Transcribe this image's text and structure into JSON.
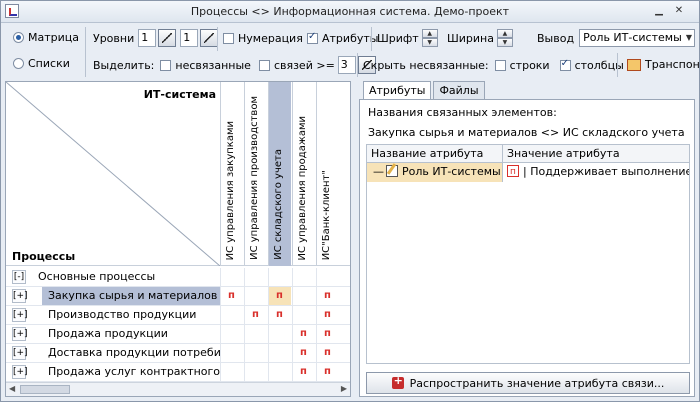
{
  "window": {
    "title": "Процессы <> Информационная система. Демо-проект"
  },
  "toolbar": {
    "mode_matrix": "Матрица",
    "mode_lists": "Списки",
    "levels_label": "Уровни",
    "levels_value_1": "1",
    "levels_value_2": "1",
    "numbering_label": "Нумерация",
    "attributes_label": "Атрибуты",
    "font_label": "Шрифт",
    "width_label": "Ширина",
    "output_label": "Вывод",
    "output_value": "Роль ИТ-системы",
    "highlight_label": "Выделить:",
    "unlinked_label": "несвязанные",
    "links_label": "связей >=",
    "links_value": "3",
    "hide_unlinked_label": "Скрыть несвязанные:",
    "rows_label": "строки",
    "cols_label": "столбцы",
    "transpose_label": "Транспон"
  },
  "matrix": {
    "column_header": "ИТ-система",
    "row_header": "Процессы",
    "columns": [
      "ИС управления закупками",
      "ИС управления производством",
      "ИС складского учета",
      "ИС управления продажами",
      "ИС\"Банк-клиент\""
    ],
    "rows": [
      {
        "expander": "[-]",
        "name": "Основные процессы",
        "marks": [
          "",
          "",
          "",
          "",
          ""
        ]
      },
      {
        "expander": "[+]",
        "name": "Закупка сырья и материалов",
        "marks": [
          "п",
          "",
          "п",
          "",
          "п"
        ]
      },
      {
        "expander": "[+]",
        "name": "Производство продукции",
        "marks": [
          "",
          "п",
          "п",
          "",
          "п"
        ]
      },
      {
        "expander": "[+]",
        "name": "Продажа продукции",
        "marks": [
          "",
          "",
          "",
          "п",
          "п"
        ]
      },
      {
        "expander": "[+]",
        "name": "Доставка продукции потребителям",
        "marks": [
          "",
          "",
          "",
          "п",
          "п"
        ]
      },
      {
        "expander": "[+]",
        "name": "Продажа услуг контрактного произ...",
        "marks": [
          "",
          "",
          "",
          "п",
          "п"
        ]
      }
    ]
  },
  "right_panel": {
    "tabs": [
      "Атрибуты",
      "Файлы"
    ],
    "linked_title": "Названия связанных элементов:",
    "linked_value": "Закупка сырья и материалов <> ИС складского учета",
    "grid_headers": [
      "Название атрибута",
      "Значение атрибута"
    ],
    "grid_row": {
      "name": "Роль ИТ-системы",
      "value": "| Поддерживает выполнение"
    },
    "apply_button": "Распространить значение атрибута связи..."
  },
  "colors": {
    "selection": "#b4bfd6",
    "highlight": "#f7e3b8",
    "mark": "#d9302b"
  }
}
